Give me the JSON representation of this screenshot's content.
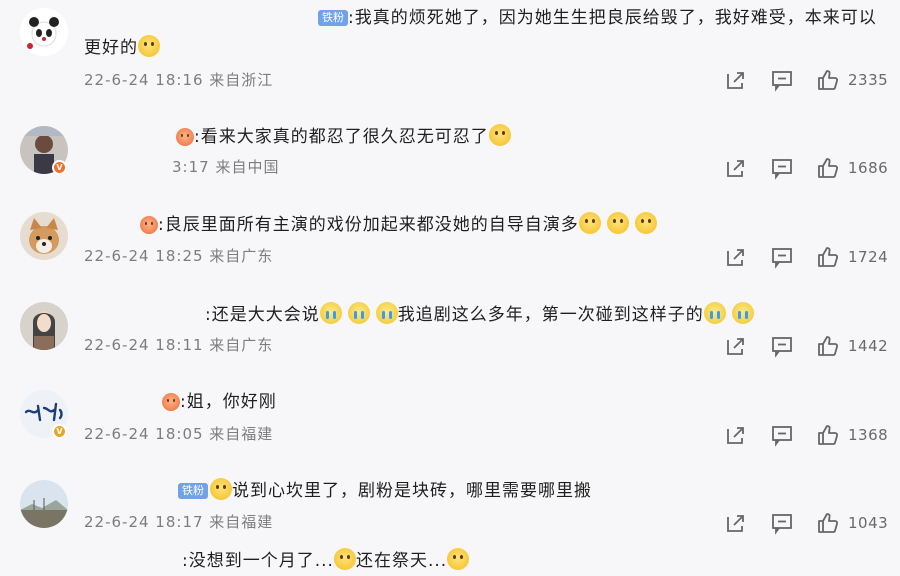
{
  "comments": [
    {
      "fan_badge": "铁粉",
      "text": ":我真的烦死她了，因为她生生把良辰给毁了，我好难受，本来可以",
      "text_cont": "更好的",
      "meta": "22-6-24 18:16 来自浙江",
      "likes": "2335",
      "avatar_icon": "panda-avatar"
    },
    {
      "text": ":看来大家真的都忍了很久忍无可忍了",
      "meta": "3:17 来自中国",
      "likes": "1686",
      "avatar_icon": "person-avatar"
    },
    {
      "text": ":良辰里面所有主演的戏份加起来都没她的自导自演多",
      "meta": "22-6-24 18:25 来自广东",
      "likes": "1724",
      "avatar_icon": "dog-avatar"
    },
    {
      "text_a": ":还是大大会说",
      "text_b": "我追剧这么多年，第一次碰到这样子的",
      "meta": "22-6-24 18:11 来自广东",
      "likes": "1442",
      "avatar_icon": "portrait-avatar"
    },
    {
      "text": ":姐，你好刚",
      "meta": "22-6-24 18:05 来自福建",
      "likes": "1368",
      "avatar_icon": "calligraphy-avatar"
    },
    {
      "fan_badge": "铁粉",
      "text": "说到心坎里了，剧粉是块砖，哪里需要哪里搬",
      "meta": "22-6-24 18:17 来自福建",
      "likes": "1043",
      "avatar_icon": "landscape-avatar"
    },
    {
      "text_a": ":没想到一个月了...",
      "text_b": "还在祭天..."
    }
  ],
  "icons": {
    "share": "share-icon",
    "reply": "comment-icon",
    "like": "thumbs-up-icon"
  },
  "colors": {
    "fan_badge": "#6fa2e6",
    "meta_text": "#7d7d7d",
    "background": "#f7f7f9"
  }
}
